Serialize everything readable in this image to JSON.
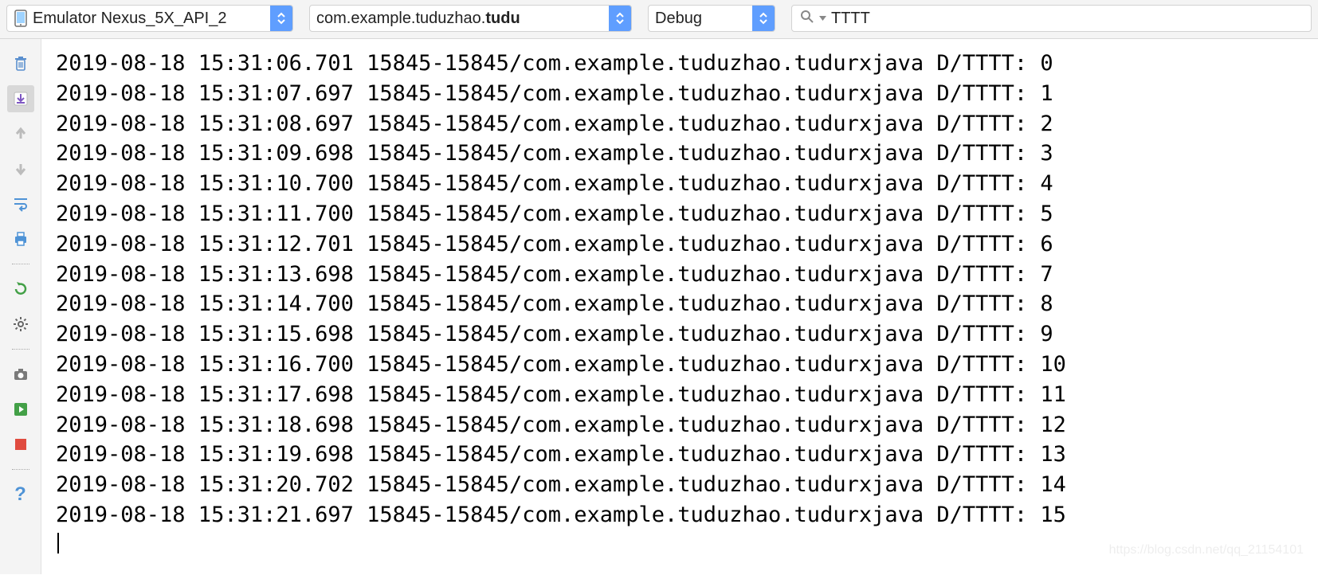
{
  "toolbar": {
    "device_label_visible": "Emulator Nexus_5X_API_2",
    "process_label_prefix": "com.example.tuduzhao.",
    "process_label_bold": "tudu",
    "loglevel_label": "Debug"
  },
  "search": {
    "value": "TTTT"
  },
  "icons": {
    "device": "phone-icon",
    "search": "search-icon",
    "trash": "trash-icon",
    "expand_down": "download-icon",
    "arrow_up": "arrow-up-icon",
    "arrow_down": "arrow-down-icon",
    "wrap": "soft-wrap-icon",
    "print": "print-icon",
    "restart": "restart-icon",
    "settings": "gear-icon",
    "screenshot": "camera-icon",
    "screen_record": "screen-record-icon",
    "stop": "stop-icon",
    "help": "help-icon"
  },
  "log": {
    "date": "2019-08-18",
    "process_tid": "15845-15845/com.example.tuduzhao.tudurxjava",
    "tag": "D/TTTT:",
    "lines": [
      {
        "time": "15:31:06.701",
        "msg": "0"
      },
      {
        "time": "15:31:07.697",
        "msg": "1"
      },
      {
        "time": "15:31:08.697",
        "msg": "2"
      },
      {
        "time": "15:31:09.698",
        "msg": "3"
      },
      {
        "time": "15:31:10.700",
        "msg": "4"
      },
      {
        "time": "15:31:11.700",
        "msg": "5"
      },
      {
        "time": "15:31:12.701",
        "msg": "6"
      },
      {
        "time": "15:31:13.698",
        "msg": "7"
      },
      {
        "time": "15:31:14.700",
        "msg": "8"
      },
      {
        "time": "15:31:15.698",
        "msg": "9"
      },
      {
        "time": "15:31:16.700",
        "msg": "10"
      },
      {
        "time": "15:31:17.698",
        "msg": "11"
      },
      {
        "time": "15:31:18.698",
        "msg": "12"
      },
      {
        "time": "15:31:19.698",
        "msg": "13"
      },
      {
        "time": "15:31:20.702",
        "msg": "14"
      },
      {
        "time": "15:31:21.697",
        "msg": "15"
      }
    ]
  },
  "watermark": "https://blog.csdn.net/qq_21154101"
}
